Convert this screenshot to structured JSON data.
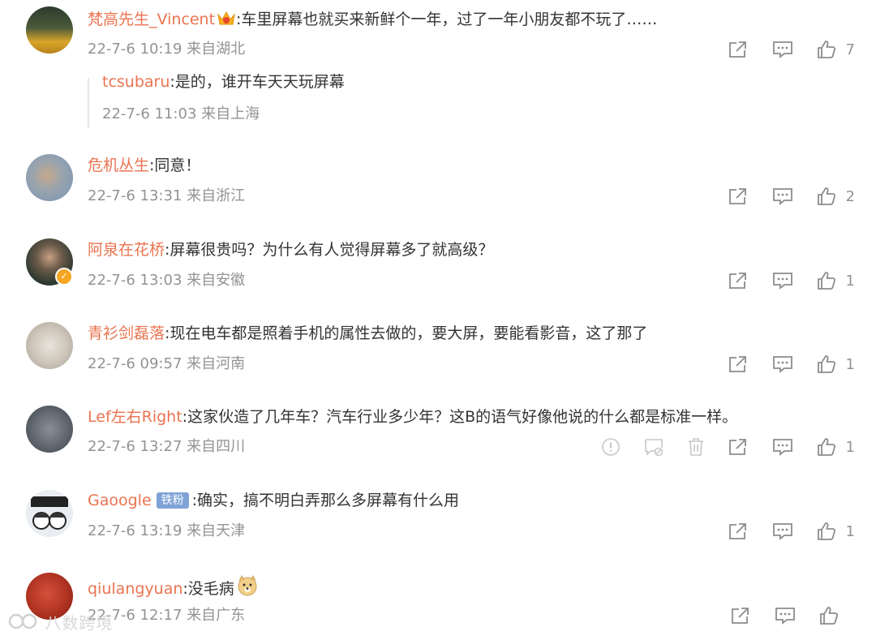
{
  "comments": [
    {
      "username": "梵高先生_Vincent",
      "text": ":车里屏幕也就买来新鲜个一年，过了一年小朋友都不玩了……",
      "meta": "22-7-6 10:19 来自湖北",
      "likes": "7",
      "reply": {
        "username": "tcsubaru",
        "text": ":是的，谁开车天天玩屏幕",
        "meta": "22-7-6 11:03 来自上海"
      }
    },
    {
      "username": "危机丛生",
      "text": ":同意！",
      "meta": "22-7-6 13:31 来自浙江",
      "likes": "2"
    },
    {
      "username": "阿泉在花桥",
      "text": ":屏幕很贵吗？为什么有人觉得屏幕多了就高级？",
      "meta": "22-7-6 13:03 来自安徽",
      "likes": "1"
    },
    {
      "username": "青衫剑磊落",
      "text": ":现在电车都是照着手机的属性去做的，要大屏，要能看影音，这了那了",
      "meta": "22-7-6 09:57 来自河南",
      "likes": "1"
    },
    {
      "username": "Lef左右Right",
      "text": ":这家伙造了几年车？汽车行业多少年？这B的语气好像他说的什么都是标准一样。",
      "meta": "22-7-6 13:27 来自四川",
      "likes": "1"
    },
    {
      "username": "Gaoogle",
      "badge": "铁粉",
      "text": ":确实，搞不明白弄那么多屏幕有什么用",
      "meta": "22-7-6 13:19 来自天津",
      "likes": "1"
    },
    {
      "username": "qiulangyuan",
      "text": ":没毛病",
      "meta": "22-7-6 12:17 来自广东",
      "likes": ""
    }
  ],
  "watermark": "八数跨境",
  "colors": {
    "username": "#eb7350",
    "meta": "#939393",
    "icon": "#8c8c8c",
    "badge": "#7fa3d6"
  }
}
